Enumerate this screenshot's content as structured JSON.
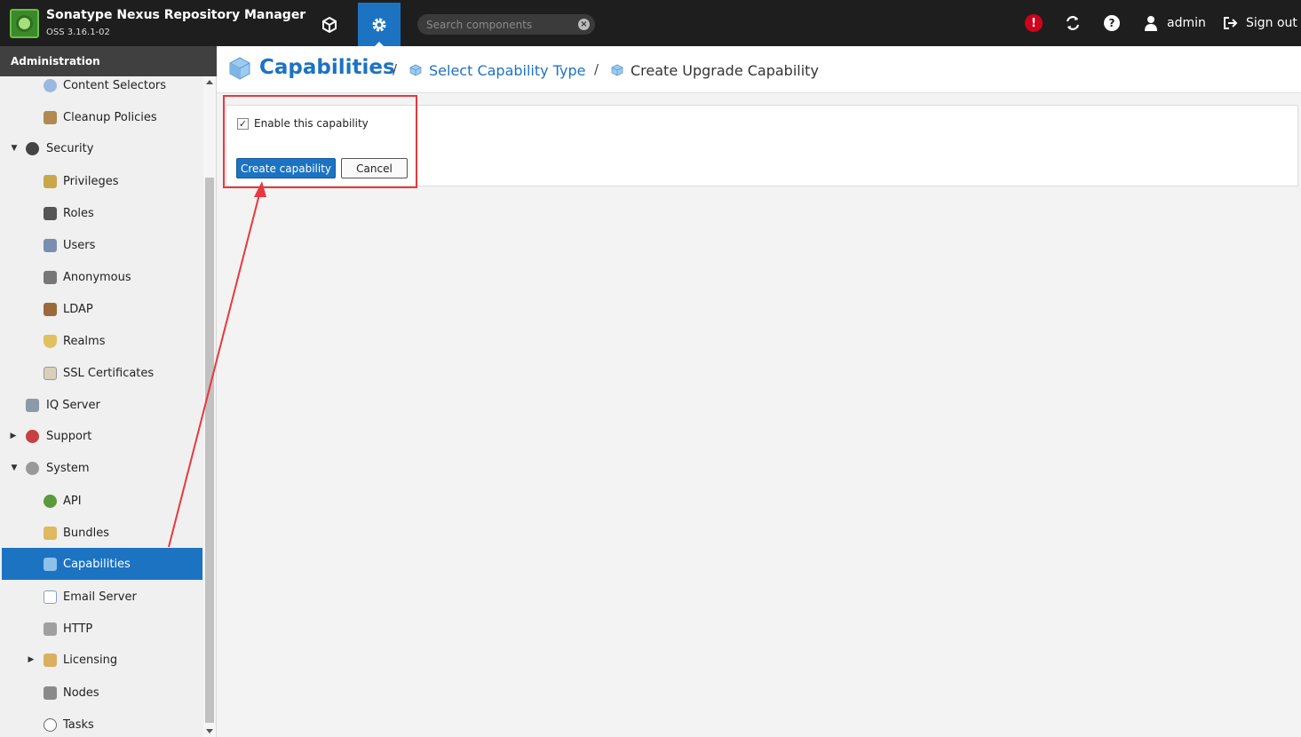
{
  "header": {
    "app_title": "Sonatype Nexus Repository Manager",
    "app_version": "OSS 3.16.1-02",
    "search_placeholder": "Search components",
    "user_name": "admin",
    "signout_label": "Sign out",
    "icons": [
      "logo",
      "cube-icon",
      "gear-icon",
      "close-icon",
      "alert-icon",
      "refresh-icon",
      "help-icon",
      "user-icon",
      "signout-icon"
    ]
  },
  "sidebar": {
    "header": "Administration",
    "items": [
      {
        "label": "Content Selectors",
        "icon": "content-selectors-icon"
      },
      {
        "label": "Cleanup Policies",
        "icon": "broom-icon"
      },
      {
        "label": "Security",
        "icon": "security-icon",
        "expanded": true
      },
      {
        "label": "Privileges",
        "icon": "medal-icon"
      },
      {
        "label": "Roles",
        "icon": "role-icon"
      },
      {
        "label": "Users",
        "icon": "users-icon"
      },
      {
        "label": "Anonymous",
        "icon": "anonymous-icon"
      },
      {
        "label": "LDAP",
        "icon": "book-icon"
      },
      {
        "label": "Realms",
        "icon": "shield-icon"
      },
      {
        "label": "SSL Certificates",
        "icon": "certificate-icon"
      },
      {
        "label": "IQ Server",
        "icon": "iq-server-icon"
      },
      {
        "label": "Support",
        "icon": "lifebuoy-icon",
        "expanded": false
      },
      {
        "label": "System",
        "icon": "system-gear-icon",
        "expanded": true
      },
      {
        "label": "API",
        "icon": "api-icon"
      },
      {
        "label": "Bundles",
        "icon": "puzzle-icon"
      },
      {
        "label": "Capabilities",
        "icon": "cube-icon",
        "selected": true
      },
      {
        "label": "Email Server",
        "icon": "envelope-icon"
      },
      {
        "label": "HTTP",
        "icon": "truck-icon"
      },
      {
        "label": "Licensing",
        "icon": "license-icon",
        "expanded": false
      },
      {
        "label": "Nodes",
        "icon": "nodes-icon"
      },
      {
        "label": "Tasks",
        "icon": "clock-icon"
      }
    ]
  },
  "breadcrumb": {
    "title": "Capabilities",
    "separator": "/",
    "select_type": "Select Capability Type",
    "current": "Create Upgrade Capability"
  },
  "form": {
    "enable_label": "Enable this capability",
    "enable_checked": true,
    "create_label": "Create capability",
    "cancel_label": "Cancel"
  },
  "colors": {
    "accent": "#1c73c2",
    "header_bg": "#1e1e1e",
    "annotation": "#e8383d",
    "alert": "#d0021b"
  }
}
